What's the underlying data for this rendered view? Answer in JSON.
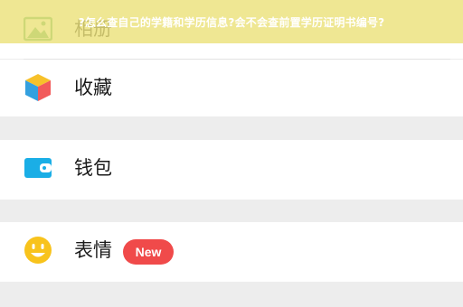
{
  "overlay": {
    "title": "?怎么查自己的学籍和学历信息?会不会查前置学历证明书编号?"
  },
  "menu": {
    "items": [
      {
        "label": "相册",
        "icon": "album-icon"
      },
      {
        "label": "收藏",
        "icon": "cube-icon"
      },
      {
        "label": "钱包",
        "icon": "wallet-icon"
      },
      {
        "label": "表情",
        "icon": "smiley-icon",
        "badge": "New"
      }
    ]
  },
  "colors": {
    "background": "#ededed",
    "row": "#ffffff",
    "badge": "#f04a4a",
    "wallet": "#1aaee6",
    "smiley": "#f8c31c",
    "album": "#4cae63",
    "banner": "#ece27b"
  }
}
